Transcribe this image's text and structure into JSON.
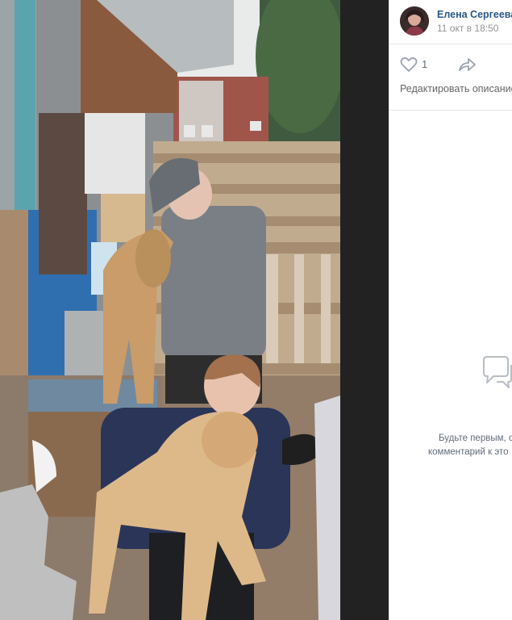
{
  "post": {
    "author_name": "Елена Сергеева",
    "date": "11 окт в 18:50",
    "likes_count": "1",
    "edit_description_label": "Редактировать описание"
  },
  "comments": {
    "empty_line1": "Будьте первым, о",
    "empty_line2": "комментарий к это"
  },
  "icons": {
    "like": "heart-icon",
    "share": "share-arrow-icon",
    "comments_placeholder": "comment-bubbles-icon"
  },
  "colors": {
    "link": "#2a5885",
    "secondary_text": "#939393",
    "icon": "#99a2ad",
    "viewer_background": "#222222",
    "panel_background": "#ffffff"
  }
}
